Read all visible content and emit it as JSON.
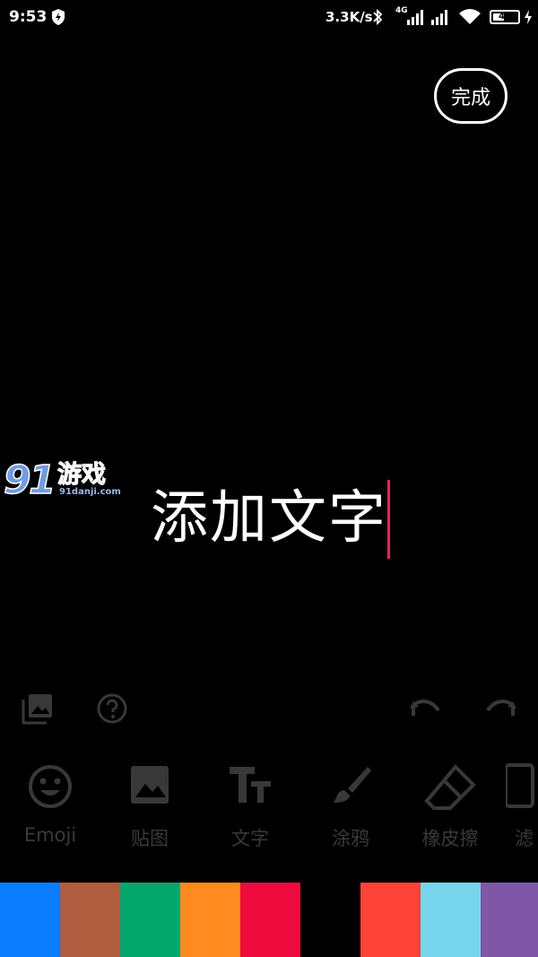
{
  "status_bar": {
    "time": "9:53",
    "net_speed": "3.3K/s",
    "network_type": "4G",
    "battery_level": "46",
    "battery_fraction": 0.46
  },
  "done_button": {
    "label": "完成"
  },
  "watermark": {
    "logo_text": "91游戏",
    "url": "91danji.com"
  },
  "text_layer": {
    "text": "添加文字",
    "caret_color": "#e0245e"
  },
  "top_tools": {
    "gallery_icon": "gallery-icon",
    "help_icon": "help-icon",
    "undo_icon": "undo-icon",
    "redo_icon": "redo-icon"
  },
  "tools": [
    {
      "label": "Emoji",
      "icon": "emoji-icon"
    },
    {
      "label": "贴图",
      "icon": "sticker-icon"
    },
    {
      "label": "文字",
      "icon": "text-icon"
    },
    {
      "label": "涂鸦",
      "icon": "brush-icon"
    },
    {
      "label": "橡皮擦",
      "icon": "eraser-icon"
    },
    {
      "label": "滤",
      "icon": "filter-icon"
    }
  ],
  "palette": [
    "#0a7cff",
    "#b15d3f",
    "#04a86f",
    "#ff8a1f",
    "#ef0a3d",
    "#000000",
    "#ff4338",
    "#77d6ec",
    "#7e58a6"
  ]
}
